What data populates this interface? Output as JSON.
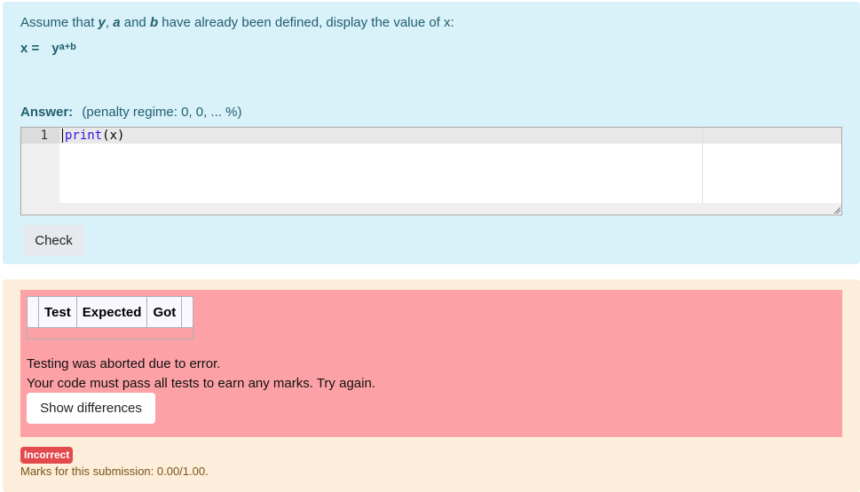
{
  "question": {
    "prompt_parts": [
      "Assume that ",
      "y",
      ", ",
      "a",
      " and ",
      "b",
      " have already been defined, display the value of x:"
    ],
    "formula_lhs": "x =",
    "formula_base": "y",
    "formula_exponent": "a+b"
  },
  "answer": {
    "label": "Answer:",
    "penalty": "(penalty regime: 0, 0, ... %)",
    "editor": {
      "line_number": "1",
      "code_keyword": "print",
      "code_rest": "(x)"
    }
  },
  "check_button": "Check",
  "results": {
    "columns": [
      "Test",
      "Expected",
      "Got"
    ],
    "message1": "Testing was aborted due to error.",
    "message2": "Your code must pass all tests to earn any marks. Try again.",
    "show_differences_button": "Show differences"
  },
  "status": {
    "badge": "Incorrect",
    "badge_color": "#e34a4d",
    "marks": "Marks for this submission: 0.00/1.00."
  }
}
